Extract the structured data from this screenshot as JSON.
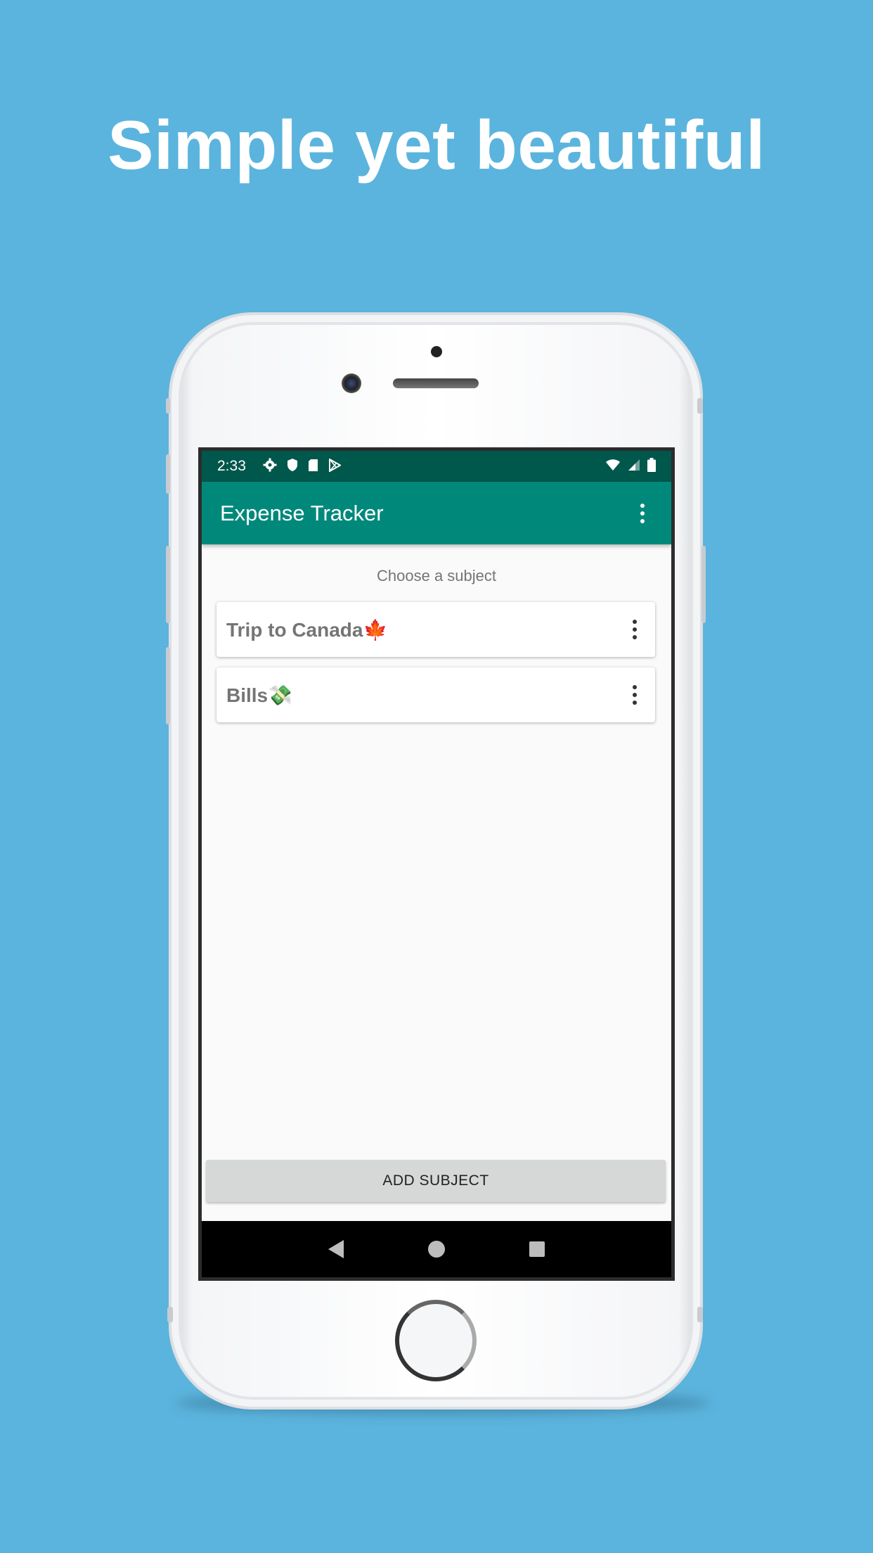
{
  "headline": "Simple yet beautiful",
  "status_bar": {
    "time": "2:33",
    "left_icons": [
      "gear-icon",
      "shield-icon",
      "sd-card-icon",
      "play-store-icon"
    ],
    "right_icons": [
      "wifi-icon",
      "cell-signal-icon",
      "battery-icon"
    ]
  },
  "app_bar": {
    "title": "Expense Tracker"
  },
  "main": {
    "hint": "Choose a subject",
    "subjects": [
      {
        "label": "Trip to Canada🍁"
      },
      {
        "label": "Bills💸"
      }
    ],
    "add_button_label": "ADD SUBJECT"
  },
  "colors": {
    "background": "#5bb4dd",
    "status_bar": "#00574b",
    "app_bar": "#00897b",
    "button": "#d6d7d7"
  }
}
